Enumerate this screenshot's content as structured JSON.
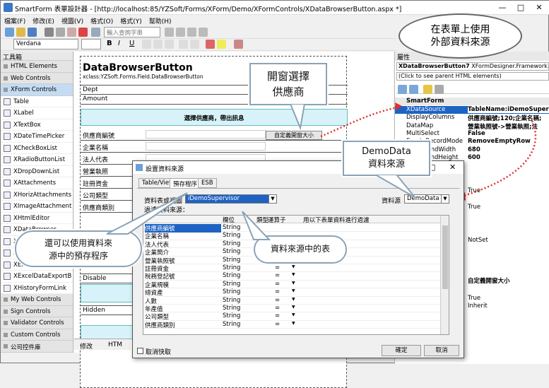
{
  "window": {
    "title": "SmartForm 表單設計器 - [http://localhost:85/YZSoft/Forms/XForm/Demo/XFormControls/XDataBrowserButton.aspx *]",
    "controls": [
      "—",
      "□",
      "✕"
    ]
  },
  "menu": [
    "檔案(F)",
    "修改(E)",
    "視圖(V)",
    "格式(O)",
    "格式(Y)",
    "幫助(H)"
  ],
  "toolbar": {
    "search_placeholder": "輸入查詢字串",
    "font": "Verdana"
  },
  "toolbox": {
    "title": "工具箱",
    "items": [
      {
        "label": "HTML Elements",
        "type": "cat"
      },
      {
        "label": "Web Controls",
        "type": "cat"
      },
      {
        "label": "XForm Controls",
        "type": "sel"
      },
      {
        "label": "Table",
        "type": "item"
      },
      {
        "label": "XLabel",
        "type": "item"
      },
      {
        "label": "XTextBox",
        "type": "item"
      },
      {
        "label": "XDateTimePicker",
        "type": "item"
      },
      {
        "label": "XCheckBoxList",
        "type": "item"
      },
      {
        "label": "XRadioButtonList",
        "type": "item"
      },
      {
        "label": "XDropDownList",
        "type": "item"
      },
      {
        "label": "XAttachments",
        "type": "item"
      },
      {
        "label": "XHorizAttachments",
        "type": "item"
      },
      {
        "label": "XImageAttachment",
        "type": "item"
      },
      {
        "label": "XHtmlEditor",
        "type": "item"
      },
      {
        "label": "XDataBrowser",
        "type": "item"
      },
      {
        "label": "XDataBrowserB",
        "type": "item"
      },
      {
        "label": "XGridLineNo",
        "type": "item"
      },
      {
        "label": "XExcelDataImp",
        "type": "item"
      },
      {
        "label": "XExcelDataExportB",
        "type": "item"
      },
      {
        "label": "XHistoryFormLink",
        "type": "item"
      },
      {
        "label": "My Web Controls",
        "type": "cat"
      },
      {
        "label": "Sign Controls",
        "type": "cat"
      },
      {
        "label": "Validator Controls",
        "type": "cat"
      },
      {
        "label": "Custom Controls",
        "type": "cat"
      },
      {
        "label": "公司控件庫",
        "type": "cat"
      }
    ]
  },
  "form": {
    "title": "DataBrowserButton",
    "subtitle": "xclass:YZSoft.Forms.Field.DataBrowserButton",
    "rows": [
      "Dept",
      "Amount"
    ],
    "header_bar": "選擇供應商，帶出訊息",
    "fields": [
      "供應商編號",
      "企業名稱",
      "法人代表",
      "營業執照",
      "註冊資金",
      "公司類型",
      "供應商類別"
    ],
    "custom_btn": "自定義開窗大小",
    "disable": "Disable",
    "hidden": "Hidden",
    "bottom_tabs": [
      "修改",
      "HTM"
    ]
  },
  "properties": {
    "title": "屬性",
    "object": "XDataBrowserButton7",
    "object_type": "XFormDesigner.Framework.Wel",
    "hint": "(Click to see parent HTML elements)",
    "category": "SmartForm",
    "rows": [
      {
        "k": "XDataSource",
        "v": "TableName:iDemoSuper"
      },
      {
        "k": "DisplayColumns",
        "v": "供應商編號;120;企業名稱;"
      },
      {
        "k": "DataMap",
        "v": "營業執照號->營業執照;法"
      },
      {
        "k": "MultiSelect",
        "v": "False"
      },
      {
        "k": "EmptyRecordMode",
        "v": "RemoveEmptyRow"
      },
      {
        "k": "PopupWndWidth",
        "v": "680"
      },
      {
        "k": "PopupWndHeight",
        "v": "600"
      }
    ],
    "extra_values": [
      "True",
      "True",
      "NotSet",
      "自定義開窗大小",
      "True",
      "Inherit"
    ]
  },
  "dialog": {
    "title": "設置資料來源",
    "tabs": [
      "Table/View",
      "預存程序",
      "ESB"
    ],
    "table_label": "資料表或視圖",
    "table_value": "iDemoSupervisor",
    "source_label": "資料源",
    "source_value": "DemoData",
    "filter_label": "過濾資料來源：",
    "columns": [
      "欄位",
      "類型",
      "運算子",
      "用以下表單資料進行過濾"
    ],
    "rows": [
      [
        "供應商編號",
        "String"
      ],
      [
        "企業名稱",
        "String"
      ],
      [
        "法人代表",
        "String"
      ],
      [
        "企業簡介",
        "String"
      ],
      [
        "營業執照號",
        "String"
      ],
      [
        "註冊資金",
        "String"
      ],
      [
        "稅務登記號",
        "String"
      ],
      [
        "企業規模",
        "String"
      ],
      [
        "總資產",
        "String"
      ],
      [
        "人數",
        "String"
      ],
      [
        "年產值",
        "String"
      ],
      [
        "公司類型",
        "String"
      ],
      [
        "供應商類別",
        "String"
      ]
    ],
    "operator": "=",
    "cancel_cache": "取消快取",
    "ok": "確定",
    "cancel": "取消"
  },
  "callouts": {
    "popup": [
      "開窗選擇",
      "供應商"
    ],
    "external": [
      "在表單上使用",
      "外部資料來源"
    ],
    "demodata": [
      "DemoData",
      "資料來源"
    ],
    "procedure": [
      "還可以使用資料來",
      "源中的預存程序"
    ],
    "table": "資料來源中的表"
  },
  "colors": {
    "accent": "#1e63c4",
    "arrow": "#e0302c",
    "cyan": "#d7f3f9"
  }
}
